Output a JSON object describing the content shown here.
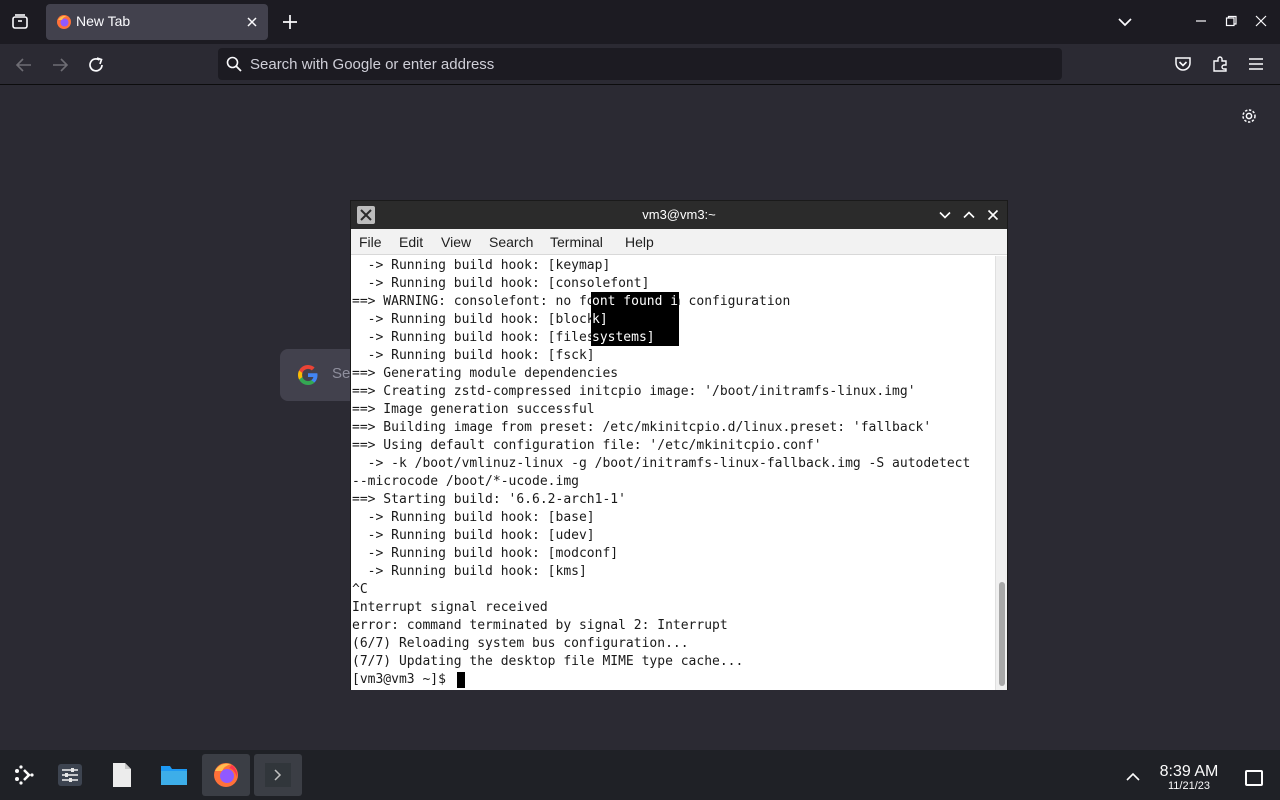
{
  "browser": {
    "tab": {
      "title": "New Tab"
    },
    "urlbar": {
      "placeholder": "Search with Google or enter address"
    },
    "newtab": {
      "search_placeholder": "Se"
    }
  },
  "terminal": {
    "title": "vm3@vm3:~",
    "menu": [
      "File",
      "Edit",
      "View",
      "Search",
      "Terminal",
      "Help"
    ],
    "lines": [
      "  -> Running build hook: [keymap]",
      "  -> Running build hook: [consolefont]",
      "==> WARNING: consolefont: no font found in configuration",
      "  -> Running build hook: [block]",
      "  -> Running build hook: [filesystems]",
      "  -> Running build hook: [fsck]",
      "==> Generating module dependencies",
      "==> Creating zstd-compressed initcpio image: '/boot/initramfs-linux.img'",
      "==> Image generation successful",
      "==> Building image from preset: /etc/mkinitcpio.d/linux.preset: 'fallback'",
      "==> Using default configuration file: '/etc/mkinitcpio.conf'",
      "  -> -k /boot/vmlinuz-linux -g /boot/initramfs-linux-fallback.img -S autodetect",
      "--microcode /boot/*-ucode.img",
      "==> Starting build: '6.6.2-arch1-1'",
      "  -> Running build hook: [base]",
      "  -> Running build hook: [udev]",
      "  -> Running build hook: [modconf]",
      "  -> Running build hook: [kms]",
      "^C",
      "Interrupt signal received",
      "error: command terminated by signal 2: Interrupt",
      "(6/7) Reloading system bus configuration...",
      "(7/7) Updating the desktop file MIME type cache...",
      "[vm3@vm3 ~]$ "
    ],
    "selection": [
      "ont found i",
      "k]",
      "systems]"
    ]
  },
  "taskbar": {
    "time": "8:39 AM",
    "date": "11/21/23"
  }
}
